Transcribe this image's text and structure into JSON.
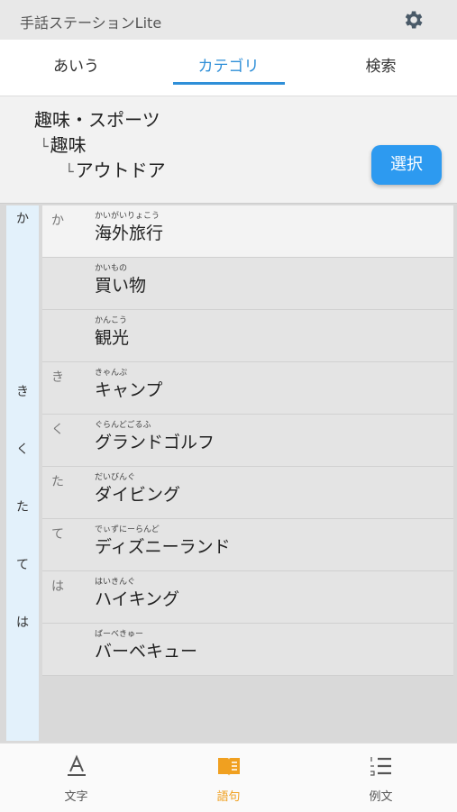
{
  "app": {
    "title": "手話ステーションLite"
  },
  "tabs": [
    {
      "label": "あいう"
    },
    {
      "label": "カテゴリ"
    },
    {
      "label": "検索"
    }
  ],
  "breadcrumb": {
    "level1": "趣味・スポーツ",
    "level2": "趣味",
    "level3": "アウトドア",
    "marker": "└"
  },
  "select_button": "選択",
  "index_letters": [
    "か",
    "き",
    "く",
    "た",
    "て",
    "は"
  ],
  "words": [
    {
      "kana": "か",
      "ruby": "かいがいりょこう",
      "word": "海外旅行"
    },
    {
      "kana": "",
      "ruby": "かいもの",
      "word": "買い物"
    },
    {
      "kana": "",
      "ruby": "かんこう",
      "word": "観光"
    },
    {
      "kana": "き",
      "ruby": "きゃんぷ",
      "word": "キャンプ"
    },
    {
      "kana": "く",
      "ruby": "ぐらんどごるふ",
      "word": "グランドゴルフ"
    },
    {
      "kana": "た",
      "ruby": "だいびんぐ",
      "word": "ダイビング"
    },
    {
      "kana": "て",
      "ruby": "でぃずにーらんど",
      "word": "ディズニーランド"
    },
    {
      "kana": "は",
      "ruby": "はいきんぐ",
      "word": "ハイキング"
    },
    {
      "kana": "",
      "ruby": "ばーべきゅー",
      "word": "バーベキュー"
    }
  ],
  "bottom_nav": [
    {
      "label": "文字",
      "icon": "letter-a-icon"
    },
    {
      "label": "語句",
      "icon": "book-icon"
    },
    {
      "label": "例文",
      "icon": "numbered-list-icon"
    }
  ],
  "colors": {
    "accent": "#2f8fd8",
    "active_nav": "#f0a020",
    "button": "#2d9af0"
  }
}
